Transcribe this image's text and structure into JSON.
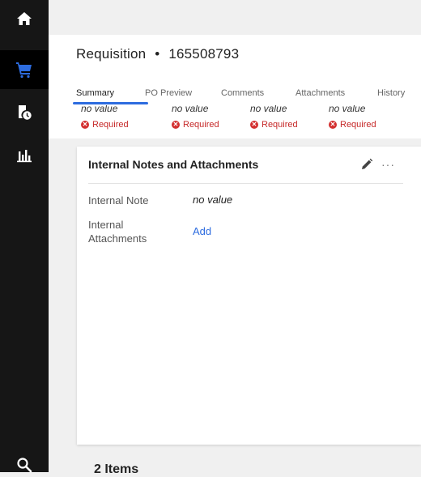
{
  "header": {
    "title": "Requisition",
    "separator": "•",
    "number": "165508793"
  },
  "tabs": [
    {
      "label": "Summary",
      "active": true
    },
    {
      "label": "PO Preview",
      "active": false
    },
    {
      "label": "Comments",
      "active": false
    },
    {
      "label": "Attachments",
      "active": false
    },
    {
      "label": "History",
      "active": false
    }
  ],
  "required_fields": [
    {
      "value": "no value",
      "status": "Required"
    },
    {
      "value": "no value",
      "status": "Required"
    },
    {
      "value": "no value",
      "status": "Required"
    },
    {
      "value": "no value",
      "status": "Required"
    }
  ],
  "card": {
    "title": "Internal Notes and Attachments",
    "more_label": "···",
    "internal_note": {
      "label": "Internal Note",
      "value": "no value"
    },
    "internal_attachments": {
      "label_line1": "Internal",
      "label_line2": "Attachments",
      "action": "Add"
    }
  },
  "items_heading": "2 Items",
  "colors": {
    "rail_bg": "#161616",
    "active_rail_icon": "#2d6cdf",
    "accent": "#2d6cdf",
    "required_red": "#d32f2f"
  },
  "icons": {
    "home": "home-icon",
    "cart": "shopping-cart-icon",
    "clock_doc": "document-clock-icon",
    "reports": "bar-chart-icon",
    "search": "search-icon",
    "edit": "pencil-icon"
  }
}
